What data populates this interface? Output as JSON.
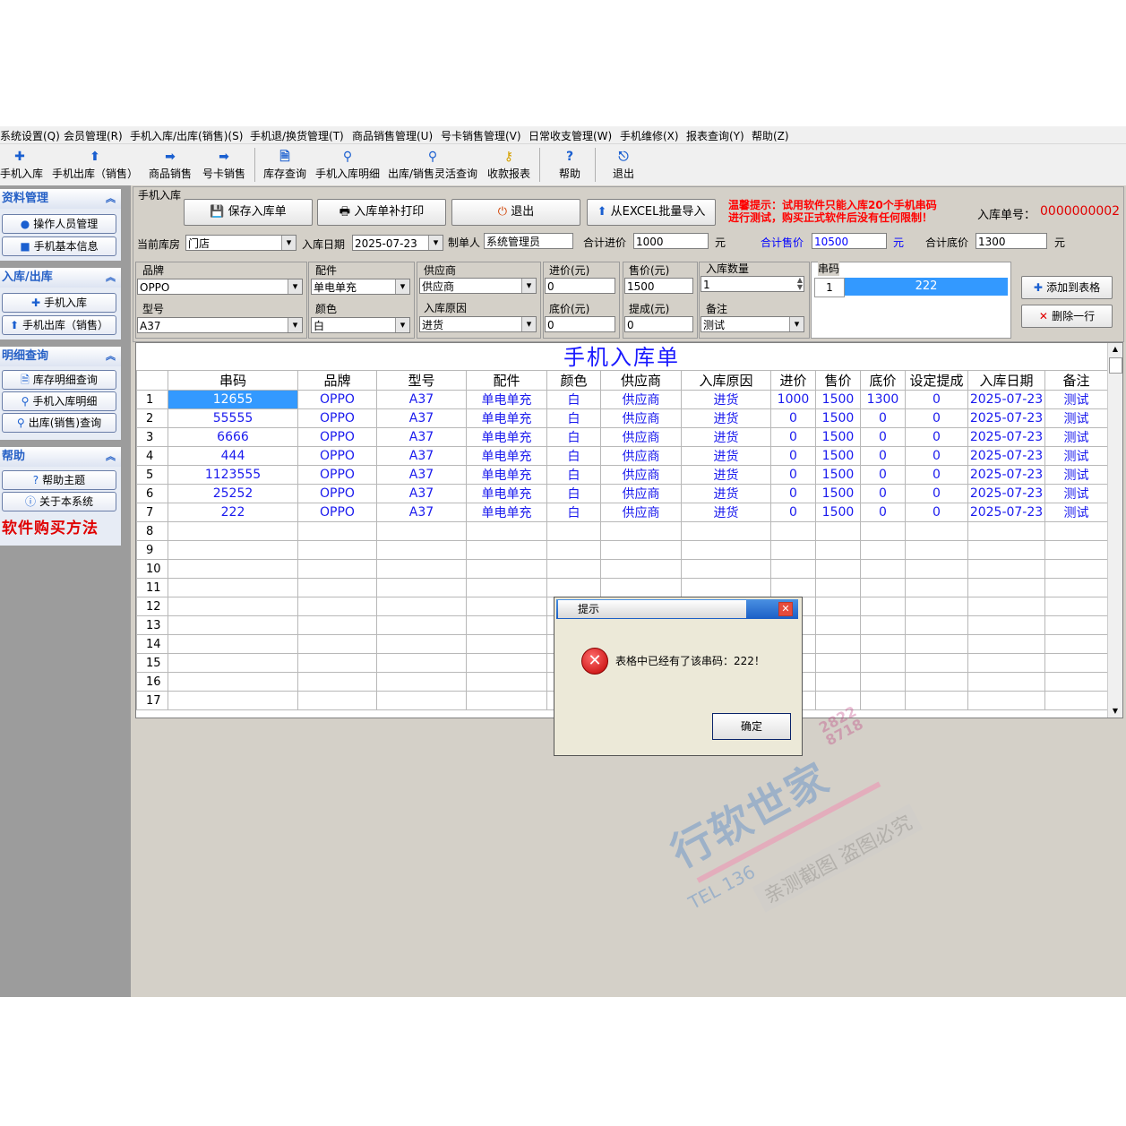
{
  "menu": [
    "系统设置(Q)",
    "会员管理(R)",
    "手机入库/出库(销售)(S)",
    "手机退/换货管理(T)",
    "商品销售管理(U)",
    "号卡销售管理(V)",
    "日常收支管理(W)",
    "手机维修(X)",
    "报表查询(Y)",
    "帮助(Z)"
  ],
  "toolbar": {
    "items": [
      {
        "label": "手机入库",
        "icon": "plus-icon"
      },
      {
        "label": "手机出库（销售）",
        "icon": "arrow-up-icon"
      },
      {
        "label": "商品销售",
        "icon": "arrow-right-icon"
      },
      {
        "label": "号卡销售",
        "icon": "arrow-right-icon"
      },
      {
        "label": "库存查询",
        "icon": "document-icon"
      },
      {
        "label": "手机入库明细",
        "icon": "magnifier-icon"
      },
      {
        "label": "出库/销售灵活查询",
        "icon": "magnifier-icon"
      },
      {
        "label": "收款报表",
        "icon": "key-icon"
      },
      {
        "label": "帮助",
        "icon": "help-icon"
      },
      {
        "label": "退出",
        "icon": "exit-icon"
      }
    ]
  },
  "sidebar": {
    "groups": [
      {
        "title": "资料管理",
        "items": [
          "操作人员管理",
          "手机基本信息"
        ]
      },
      {
        "title": "入库/出库",
        "items": [
          "手机入库",
          "手机出库（销售）"
        ]
      },
      {
        "title": "明细查询",
        "items": [
          "库存明细查询",
          "手机入库明细",
          "出库(销售)查询"
        ]
      },
      {
        "title": "帮助",
        "items": [
          "帮助主题",
          "关于本系统"
        ]
      }
    ],
    "buy_link": "软件购买方法"
  },
  "form": {
    "frame_title": "手机入库",
    "buttons": {
      "save": "保存入库单",
      "reprint": "入库单补打印",
      "exit": "退出",
      "import": "从EXCEL批量导入"
    },
    "warning": "温馨提示：试用软件只能入库20个手机串码\n进行测试，购买正式软件后没有任何限制！",
    "order_no_label": "入库单号：",
    "order_no": "0000000002",
    "warehouse_label": "当前库房",
    "warehouse": "门店",
    "date_label": "入库日期",
    "date": "2025-07-23",
    "maker_label": "制单人",
    "maker": "系统管理员",
    "total_cost_label": "合计进价",
    "total_cost": "1000",
    "total_sale_label": "合计售价",
    "total_sale": "10500",
    "total_floor_label": "合计底价",
    "total_floor": "1300",
    "yuan": "元",
    "brand_label": "品牌",
    "brand": "OPPO",
    "accessory_label": "配件",
    "accessory": "单电单充",
    "supplier_label": "供应商",
    "supplier": "供应商",
    "cost_label": "进价(元)",
    "cost": "0",
    "price_label": "售价(元)",
    "price": "1500",
    "qty_label": "入库数量",
    "qty": "1",
    "serial_label": "串码",
    "serial_idx": "1",
    "serial": "222",
    "model_label": "型号",
    "model": "A37",
    "color_label": "颜色",
    "color": "白",
    "reason_label": "入库原因",
    "reason": "进货",
    "floor_label": "底价(元)",
    "floor": "0",
    "commission_label": "提成(元)",
    "commission": "0",
    "note_label": "备注",
    "note": "测试",
    "add_button": "添加到表格",
    "delete_button": "删除一行"
  },
  "grid": {
    "title": "手机入库单",
    "columns": [
      "",
      "串码",
      "品牌",
      "型号",
      "配件",
      "颜色",
      "供应商",
      "入库原因",
      "进价",
      "售价",
      "底价",
      "设定提成",
      "入库日期",
      "备注"
    ],
    "rows": [
      [
        "1",
        "12655",
        "OPPO",
        "A37",
        "单电单充",
        "白",
        "供应商",
        "进货",
        "1000",
        "1500",
        "1300",
        "0",
        "2025-07-23",
        "测试"
      ],
      [
        "2",
        "55555",
        "OPPO",
        "A37",
        "单电单充",
        "白",
        "供应商",
        "进货",
        "0",
        "1500",
        "0",
        "0",
        "2025-07-23",
        "测试"
      ],
      [
        "3",
        "6666",
        "OPPO",
        "A37",
        "单电单充",
        "白",
        "供应商",
        "进货",
        "0",
        "1500",
        "0",
        "0",
        "2025-07-23",
        "测试"
      ],
      [
        "4",
        "444",
        "OPPO",
        "A37",
        "单电单充",
        "白",
        "供应商",
        "进货",
        "0",
        "1500",
        "0",
        "0",
        "2025-07-23",
        "测试"
      ],
      [
        "5",
        "1123555",
        "OPPO",
        "A37",
        "单电单充",
        "白",
        "供应商",
        "进货",
        "0",
        "1500",
        "0",
        "0",
        "2025-07-23",
        "测试"
      ],
      [
        "6",
        "25252",
        "OPPO",
        "A37",
        "单电单充",
        "白",
        "供应商",
        "进货",
        "0",
        "1500",
        "0",
        "0",
        "2025-07-23",
        "测试"
      ],
      [
        "7",
        "222",
        "OPPO",
        "A37",
        "单电单充",
        "白",
        "供应商",
        "进货",
        "0",
        "1500",
        "0",
        "0",
        "2025-07-23",
        "测试"
      ]
    ],
    "empty_rows": [
      "8",
      "9",
      "10",
      "11",
      "12",
      "13",
      "14",
      "15",
      "16",
      "17"
    ]
  },
  "dialog": {
    "title": "提示",
    "message": "表格中已经有了该串码：222！",
    "ok": "确定"
  },
  "watermark": {
    "brand": "行软世家",
    "tel": "TEL 136",
    "nums": "2822 8718",
    "slogan": "亲测截图 盗图必究"
  },
  "colors": {
    "accent": "#1a1aff",
    "selection": "#3399ff",
    "warning": "#ff0000"
  }
}
